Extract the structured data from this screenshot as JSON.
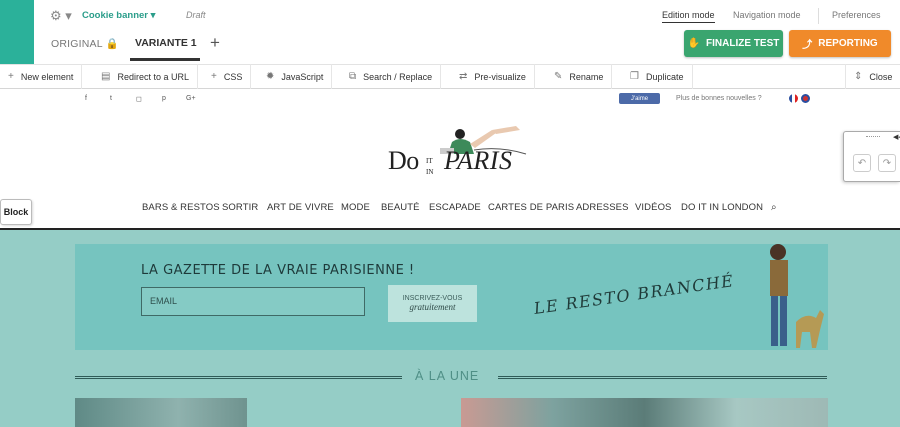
{
  "header": {
    "campaign_name": "Cookie banner",
    "status": "Draft",
    "tabs": {
      "original": "ORIGINAL",
      "variant": "VARIANTE 1"
    },
    "modes": {
      "edition": "Edition mode",
      "navigation": "Navigation mode",
      "preferences": "Preferences"
    },
    "finalize_label": "FINALIZE TEST",
    "reporting_label": "REPORTING"
  },
  "toolbar": {
    "new_element": "New element",
    "redirect": "Redirect to a URL",
    "css": "CSS",
    "javascript": "JavaScript",
    "search_replace": "Search / Replace",
    "previsualize": "Pre-visualize",
    "rename": "Rename",
    "duplicate": "Duplicate",
    "close": "Close"
  },
  "site": {
    "like_label": "J'aime",
    "news_question": "Plus de bonnes nouvelles ?",
    "brand_do": "Do",
    "brand_it": "IT",
    "brand_in": "IN",
    "brand_paris": "PARIS",
    "nav": [
      "BARS & RESTOS",
      "SORTIR",
      "ART DE VIVRE",
      "MODE",
      "BEAUTÉ",
      "ESCAPADE",
      "CARTES DE PARIS",
      "ADRESSES",
      "VIDÉOS",
      "DO IT IN LONDON"
    ],
    "newsletter": {
      "title": "LA GAZETTE DE LA VRAIE PARISIENNE !",
      "email_placeholder": "EMAIL",
      "subscribe_line1": "INSCRIVEZ-VOUS",
      "subscribe_line2": "gratuitement",
      "tagline": "LE RESTO BRANCHÉ"
    },
    "section_title": "À LA UNE"
  },
  "editor": {
    "block_tag": "Block"
  },
  "colors": {
    "brand_teal": "#2bb19a",
    "finalize_green": "#3aa56f",
    "reporting_orange": "#f08a2a",
    "selected_block": "#95cdc6"
  },
  "icons": {
    "settings": "gear-icon",
    "lock": "lock-icon",
    "add": "plus-icon",
    "finalize": "thumbs-up-icon",
    "reporting": "chart-icon",
    "close": "sort-icon",
    "search": "search-icon"
  }
}
